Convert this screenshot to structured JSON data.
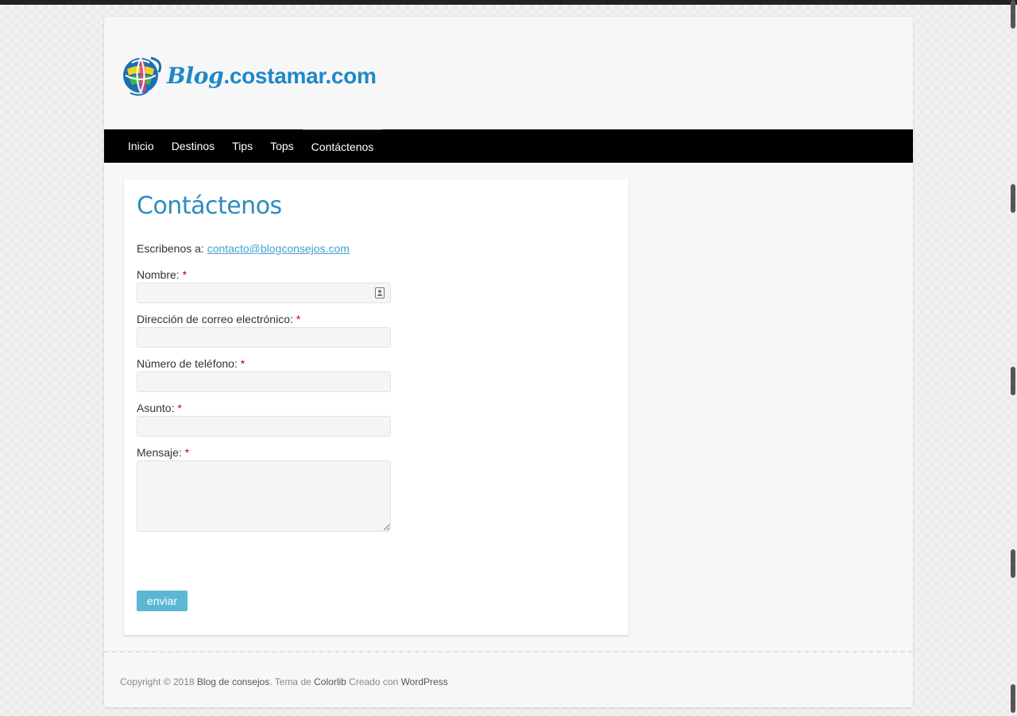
{
  "site": {
    "logo_blog": "Blog",
    "logo_domain": ".costamar.com"
  },
  "nav": {
    "items": [
      {
        "label": "Inicio"
      },
      {
        "label": "Destinos"
      },
      {
        "label": "Tips"
      },
      {
        "label": "Tops"
      },
      {
        "label": "Contáctenos"
      }
    ]
  },
  "page": {
    "title": "Contáctenos",
    "intro_prefix": "Escribenos a:",
    "intro_email": "contacto@blogconsejos.com"
  },
  "form": {
    "required_mark": "*",
    "fields": [
      {
        "label": "Nombre:",
        "value": ""
      },
      {
        "label": "Dirección de correo electrónico:",
        "value": ""
      },
      {
        "label": "Número de teléfono:",
        "value": ""
      },
      {
        "label": "Asunto:",
        "value": ""
      },
      {
        "label": "Mensaje:",
        "value": ""
      }
    ],
    "submit_label": "enviar"
  },
  "footer": {
    "copyright": "Copyright © 2018",
    "site_link": "Blog de consejos",
    "theme_text": ". Tema de",
    "theme_link": "Colorlib",
    "created_text": "Creado con",
    "wp_link": "WordPress"
  },
  "colors": {
    "accent": "#2e8bbd",
    "link": "#43a3d3",
    "button": "#5bb7d4",
    "nav_bg": "#000000"
  }
}
